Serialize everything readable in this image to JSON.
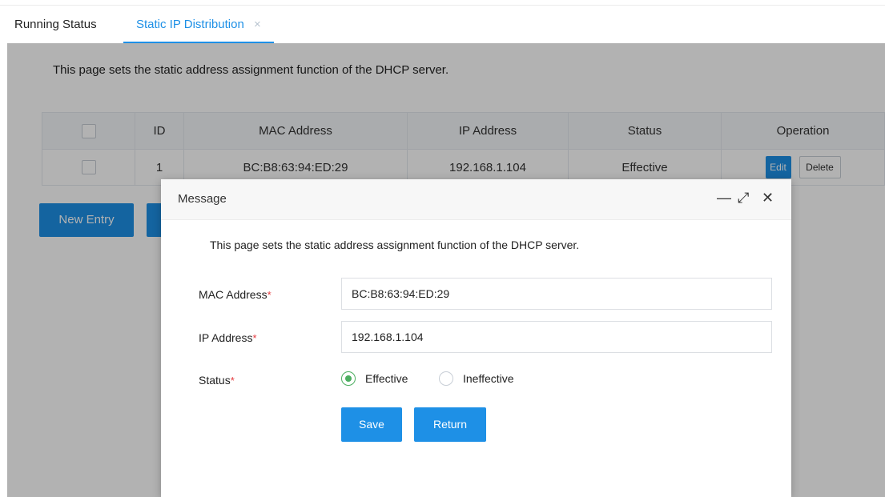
{
  "tabs": [
    {
      "label": "Running Status"
    },
    {
      "label": "Static IP Distribution"
    }
  ],
  "tab_close_glyph": "×",
  "page": {
    "intro": "This page sets the static address assignment function of the DHCP server.",
    "table": {
      "headers": [
        "",
        "ID",
        "MAC Address",
        "IP Address",
        "Status",
        "Operation"
      ],
      "rows": [
        {
          "id": "1",
          "mac": "BC:B8:63:94:ED:29",
          "ip": "192.168.1.104",
          "status": "Effective",
          "edit": "Edit",
          "delete": "Delete"
        }
      ]
    },
    "new_entry_label": "New Entry"
  },
  "modal": {
    "title": "Message",
    "minimize_icon": "—",
    "maximize_icon": "⤢",
    "close_icon": "✕",
    "description": "This page sets the static address assignment function of the DHCP server.",
    "mac_label": "MAC Address",
    "mac_value": "BC:B8:63:94:ED:29",
    "ip_label": "IP Address",
    "ip_value": "192.168.1.104",
    "status_label": "Status",
    "required_mark": "*",
    "status_options": [
      "Effective",
      "Ineffective"
    ],
    "status_selected": "Effective",
    "save_label": "Save",
    "return_label": "Return"
  },
  "colors": {
    "accent": "#1e90e6",
    "radio_selected": "#4cae60",
    "required": "#e4393c"
  }
}
